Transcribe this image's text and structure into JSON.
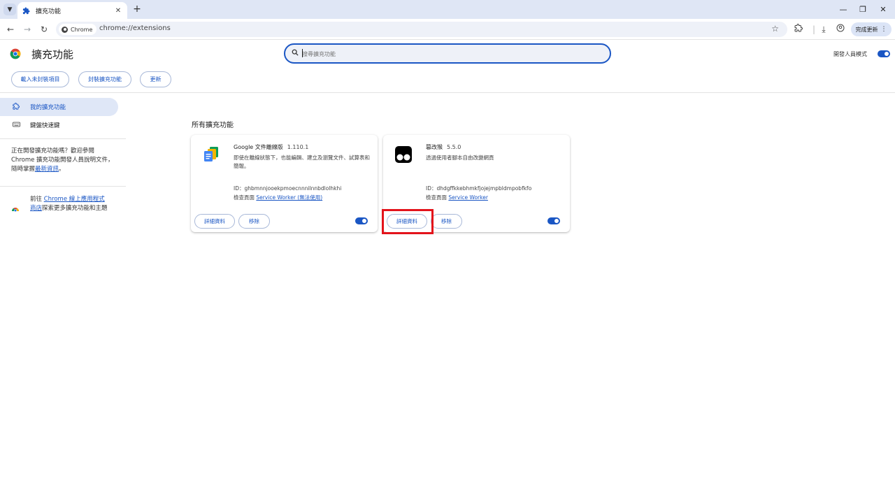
{
  "window": {
    "tab_title": "擴充功能",
    "new_tab": "+",
    "tab_close": "✕"
  },
  "toolbar": {
    "chip_label": "Chrome",
    "url": "chrome://extensions",
    "update_label": "完成更新"
  },
  "header": {
    "title": "擴充功能",
    "search_placeholder": "搜尋擴充功能",
    "dev_mode_label": "開發人員模式",
    "dev_mode_on": true,
    "buttons": [
      "載入未封裝項目",
      "封裝擴充功能",
      "更新"
    ]
  },
  "sidebar": {
    "items": [
      {
        "label": "我的擴充功能",
        "icon": "puzzle-icon",
        "active": true
      },
      {
        "label": "鍵盤快速鍵",
        "icon": "keyboard-icon",
        "active": false
      }
    ],
    "dev_note_pre": "正在開發擴充功能嗎？歡迎參閱 Chrome 擴充功能開發人員說明文件，隨時掌握",
    "dev_note_link": "最新資訊",
    "dev_note_post": "。",
    "store_pre": "前往 ",
    "store_link": "Chrome 線上應用程式商店",
    "store_post": "探索更多擴充功能和主題"
  },
  "main": {
    "section_title": "所有擴充功能",
    "extensions": [
      {
        "name": "Google 文件離線版",
        "version": "1.110.1",
        "description": "即使在離線狀態下，也能編輯、建立及瀏覽文件、試算表和簡報。",
        "id": "ID：ghbmnnjooekpmoecnnnilnnbdlolhkhi",
        "inspect_label": "檢查頁面",
        "inspect_link": "Service Worker (無法使用)",
        "details_label": "詳細資料",
        "remove_label": "移除",
        "enabled": true,
        "icon": "google-docs-offline-icon"
      },
      {
        "name": "篡改猴",
        "version": "5.5.0",
        "description": "透過使用者腳本自由改變網頁",
        "id": "ID：dhdgffkkebhmkfjojejmpbldmpobfkfo",
        "inspect_label": "檢查頁面",
        "inspect_link": "Service Worker",
        "details_label": "詳細資料",
        "remove_label": "移除",
        "enabled": true,
        "icon": "tampermonkey-icon"
      }
    ]
  },
  "colors": {
    "accent": "#1a56c4",
    "highlight": "#e3131b"
  }
}
